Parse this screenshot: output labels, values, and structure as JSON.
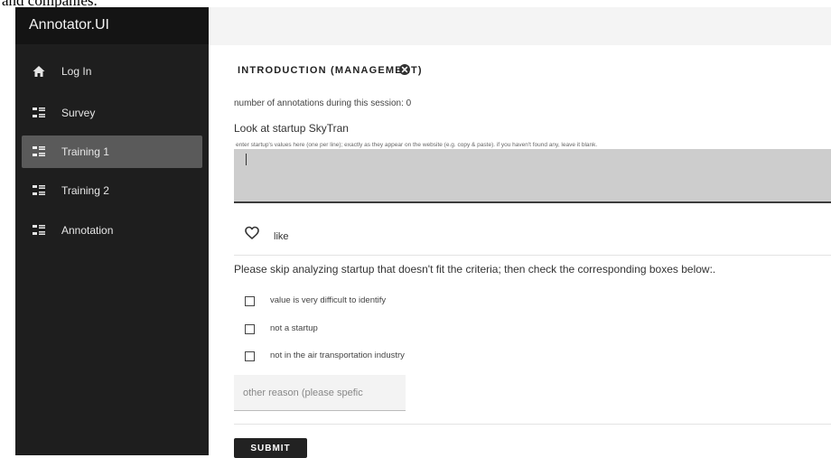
{
  "top_text": "and companies.",
  "app": {
    "brand": "Annotator.UI",
    "nav": [
      {
        "label": "Log In",
        "icon": "home-icon",
        "active": false
      },
      {
        "label": "Survey",
        "icon": "list-icon",
        "active": false
      },
      {
        "label": "Training 1",
        "icon": "list-icon",
        "active": true
      },
      {
        "label": "Training 2",
        "icon": "list-icon",
        "active": false
      },
      {
        "label": "Annotation",
        "icon": "list-icon",
        "active": false
      }
    ]
  },
  "main": {
    "section_title": "INTRODUCTION (MANAGEMENT)",
    "annotation_count_text": "number of annotations during this session: 0",
    "look_at_text": "Look at startup SkyTran",
    "values_label": "enter startup's values here (one per line); exactly as they appear on the website (e.g. copy & paste). if you haven't found any, leave it blank.",
    "values_value": "",
    "like_label": "like",
    "skip_text": "Please skip analyzing startup that doesn't fit the criteria; then check the corresponding boxes below:.",
    "checkboxes": [
      {
        "label": "value is very difficult to identify",
        "checked": false
      },
      {
        "label": "not a startup",
        "checked": false
      },
      {
        "label": "not in the air transportation industry",
        "checked": false
      }
    ],
    "other_reason_placeholder": "other reason (please spefic",
    "submit_label": "SUBMIT"
  },
  "colors": {
    "sidebar": "#1e1e1e",
    "brand_bar": "#141414",
    "active_item": "#5a5a5a",
    "header": "#f4f4f4",
    "textarea": "#cdcdcd",
    "submit": "#222222"
  }
}
